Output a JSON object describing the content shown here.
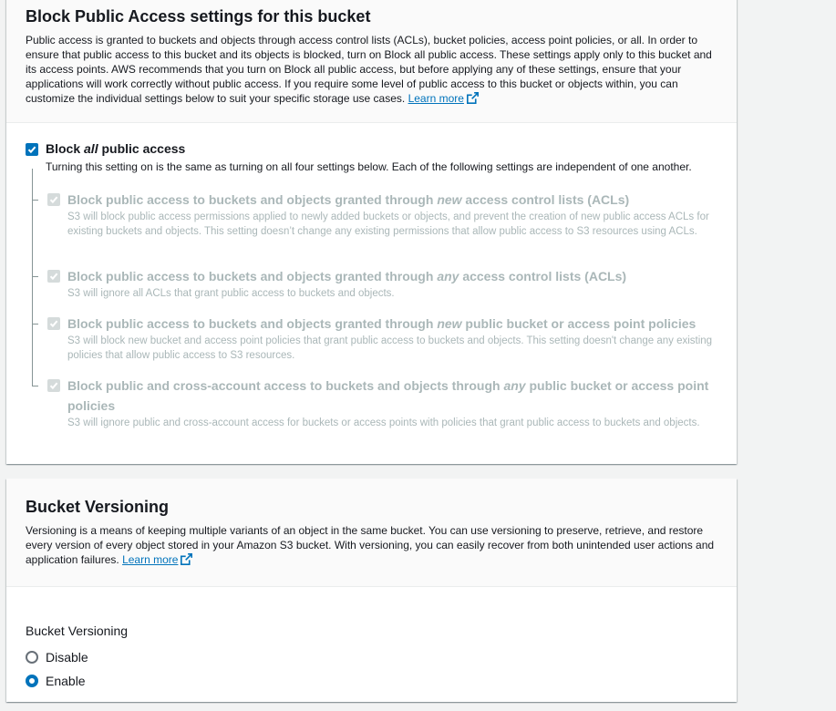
{
  "bpa": {
    "title": "Block Public Access settings for this bucket",
    "desc": "Public access is granted to buckets and objects through access control lists (ACLs), bucket policies, access point policies, or all. In order to ensure that public access to this bucket and its objects is blocked, turn on Block all public access. These settings apply only to this bucket and its access points. AWS recommends that you turn on Block all public access, but before applying any of these settings, ensure that your applications will work correctly without public access. If you require some level of public access to this bucket or objects within, you can customize the individual settings below to suit your specific storage use cases.",
    "learn_more": "Learn more",
    "block_all": {
      "label_pre": "Block ",
      "label_em": "all",
      "label_post": " public access",
      "checked": true,
      "desc": "Turning this setting on is the same as turning on all four settings below. Each of the following settings are independent of one another."
    },
    "options": [
      {
        "label_pre": "Block public access to buckets and objects granted through ",
        "label_em": "new",
        "label_post": " access control lists (ACLs)",
        "desc": "S3 will block public access permissions applied to newly added buckets or objects, and prevent the creation of new public access ACLs for existing buckets and objects. This setting doesn’t change any existing permissions that allow public access to S3 resources using ACLs.",
        "checked": true,
        "disabled": true
      },
      {
        "label_pre": "Block public access to buckets and objects granted through ",
        "label_em": "any",
        "label_post": " access control lists (ACLs)",
        "desc": "S3 will ignore all ACLs that grant public access to buckets and objects.",
        "checked": true,
        "disabled": true
      },
      {
        "label_pre": "Block public access to buckets and objects granted through ",
        "label_em": "new",
        "label_post": " public bucket or access point policies",
        "desc": "S3 will block new bucket and access point policies that grant public access to buckets and objects. This setting doesn't change any existing policies that allow public access to S3 resources.",
        "checked": true,
        "disabled": true
      },
      {
        "label_pre": "Block public and cross-account access to buckets and objects through ",
        "label_em": "any",
        "label_post": " public bucket or access point policies",
        "desc": "S3 will ignore public and cross-account access for buckets or access points with policies that grant public access to buckets and objects.",
        "checked": true,
        "disabled": true
      }
    ]
  },
  "versioning": {
    "title": "Bucket Versioning",
    "desc": "Versioning is a means of keeping multiple variants of an object in the same bucket. You can use versioning to preserve, retrieve, and restore every version of every object stored in your Amazon S3 bucket. With versioning, you can easily recover from both unintended user actions and application failures.",
    "learn_more": "Learn more",
    "field_label": "Bucket Versioning",
    "options": [
      {
        "label": "Disable",
        "selected": false
      },
      {
        "label": "Enable",
        "selected": true
      }
    ]
  },
  "colors": {
    "accent": "#0073bb",
    "disabled_text": "#aab7b8",
    "link": "#0073bb"
  },
  "icons": {
    "external_link": "external-link-icon",
    "check": "check-icon"
  }
}
